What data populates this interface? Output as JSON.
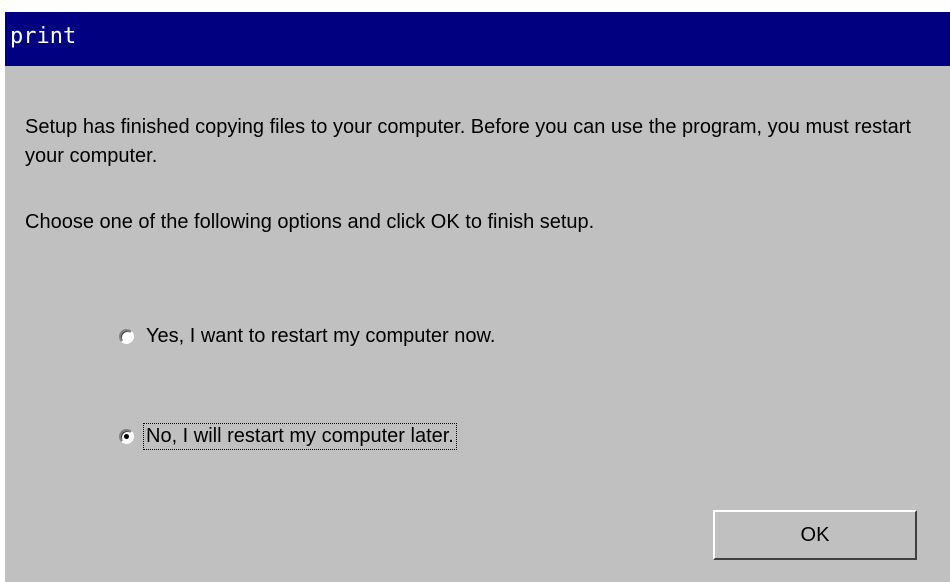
{
  "dialog": {
    "title": "print",
    "message": "Setup has finished copying files to your computer.  Before you can use the program, you must restart your computer.",
    "instruction": "Choose one of the following options and click OK to finish setup.",
    "options": [
      {
        "label": "Yes, I want to restart my computer now.",
        "selected": false
      },
      {
        "label": "No, I will restart my computer later.",
        "selected": true
      }
    ],
    "ok_label": "OK"
  },
  "colors": {
    "titlebar": "#000080",
    "title_text": "#ffffff",
    "dialog_bg": "#c0c0c0"
  }
}
